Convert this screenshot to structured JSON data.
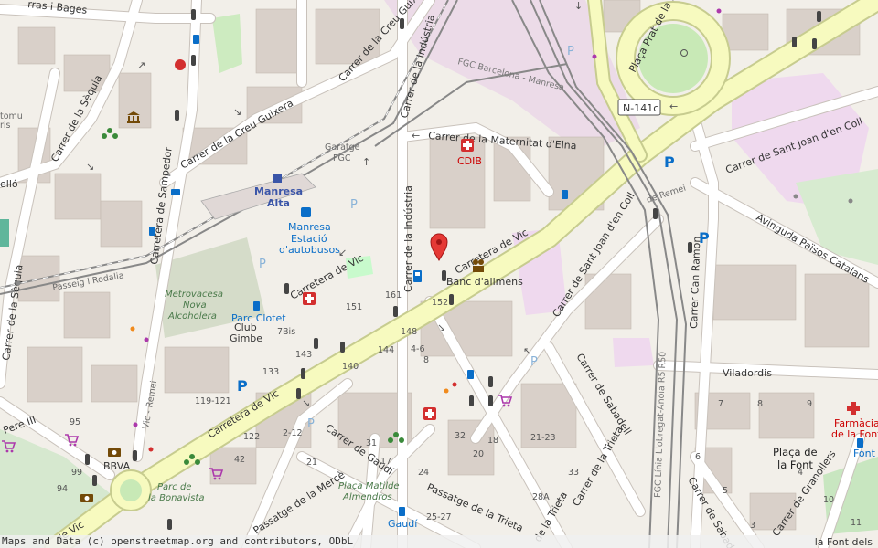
{
  "streets": {
    "vic_main": "Carretera de Vic",
    "vic_low": "Carretera de Vic",
    "vic_edge": "de Vic",
    "industria": "Carrer de la Indústria",
    "industria_top": "Carrer de la Indústria",
    "creu_guixera_a": "Carrer de la Creu Guixera",
    "creu_guixera_b": "Carrer de la Creu Guixera",
    "sequia_a": "Carrer de la Sèquia",
    "sequia_b": "Carrer de la Sèquia",
    "sampedor": "Carretera de Sampedor",
    "maternitat": "Carrer de la Maternitat d'Elna",
    "sant_joan_coll_a": "Carrer de Sant Joan d'en Coll",
    "sant_joan_coll_b": "Carrer de Sant Joan d'en Coll",
    "sabadell_a": "Carrer de Sabadell",
    "sabadell_b": "Carrer de Sabadell",
    "trieta_a": "Carrer de la Trieta",
    "trieta_b": "Passatge de la Trieta",
    "trieta_c": "de la Trieta",
    "can_ramon": "Carrer Can Ramon",
    "paisos_catalans": "Avinguda Països Catalans",
    "placa_prat": "Plaça Prat de la Riba",
    "viladordis": "Viladordis",
    "merce": "Passatge de la Mercè",
    "gaudi": "Carrer de Gaudí",
    "granollers": "Carrer de Granollers",
    "pere_iii": "Pere III",
    "passeig_rodalia": "Passeig i Rodalia",
    "remei": "de Remei",
    "vic_remei": "Vic - Remei",
    "bages": "rras i Bages",
    "cello": "elló",
    "sequia_left": "a Sèquia",
    "tomu": "tomu",
    "ris": "ris",
    "n141c": "N-141c",
    "placa_font": "Plaça de\nla Font",
    "placa_font_1": "Plaça de",
    "placa_font_2": "la Font"
  },
  "rail": {
    "fgc_barcelona": "FGC Barcelona - Manresa",
    "fgc_linia": "FGC Línia Llobregat-Anoia R5 R50",
    "garatge": "Garatge",
    "fgc": "FGC",
    "manresa_alta_1": "Manresa",
    "manresa_alta_2": "Alta"
  },
  "pois": {
    "estacio_1": "Manresa",
    "estacio_2": "Estació",
    "estacio_3": "d'autobusos",
    "cdib": "CDIB",
    "banc_alimens": "Banc d'alimens",
    "parc_clotet": "Parc Clotet",
    "club_gimbe_1": "Club",
    "club_gimbe_2": "Gimbe",
    "metrovacesa_1": "Metrovacesa",
    "metrovacesa_2": "Nova",
    "metrovacesa_3": "Alcoholera",
    "parc_bonavista_1": "Parc de",
    "parc_bonavista_2": "la Bonavista",
    "placa_matilde_1": "Plaça Matilde",
    "placa_matilde_2": "Almendros",
    "gaudi_stop": "Gaudí",
    "bbva": "BBVA",
    "farmacia_1": "Farmàcia",
    "farmacia_2": "de la Font",
    "font_stop": "Font",
    "font_deis": "la Font dels"
  },
  "house_numbers": [
    "151",
    "161",
    "152",
    "148",
    "7Bis",
    "143",
    "144",
    "4-6",
    "140",
    "8",
    "133",
    "119-121",
    "95",
    "122",
    "2-12",
    "31",
    "32",
    "18",
    "20",
    "21-23",
    "33",
    "28A",
    "21",
    "17",
    "24",
    "25-27",
    "42",
    "99",
    "94",
    "7",
    "8",
    "9",
    "10",
    "11",
    "6",
    "5",
    "3",
    "4"
  ],
  "attribution": "Maps and Data (c) openstreetmap.org and contributors, ODbL",
  "colors": {
    "background": "#f2efe9",
    "primary_road": "#f7fabf",
    "primary_casing": "#c7cc8f",
    "building": "#d9d0c9",
    "rail": "#888888",
    "park": "#c8facc",
    "marker": "#e53935",
    "pink_area": "#ecdaec"
  }
}
